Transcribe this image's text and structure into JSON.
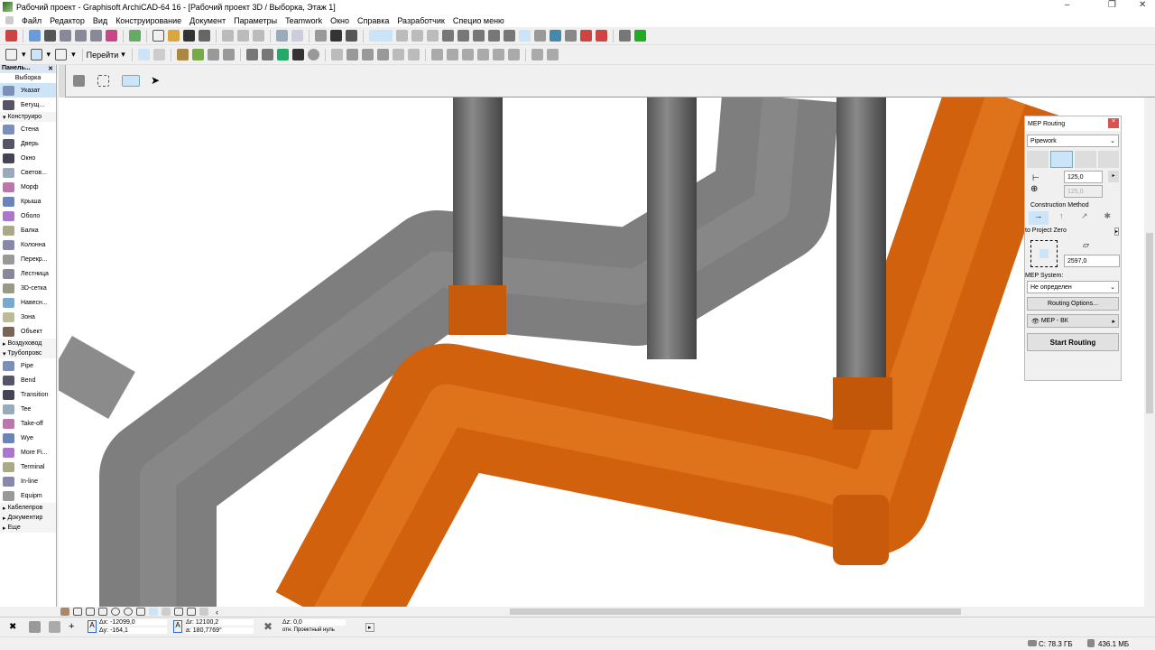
{
  "window": {
    "title": "Рабочий проект - Graphisoft ArchiCAD-64 16 - [Рабочий проект 3D / Выборка, Этаж 1]",
    "minimize": "–",
    "maximize": "❐",
    "close": "✕"
  },
  "menu": [
    "Файл",
    "Редактор",
    "Вид",
    "Конструирование",
    "Документ",
    "Параметры",
    "Teamwork",
    "Окно",
    "Справка",
    "Разработчик",
    "Специо меню"
  ],
  "toolbar2": {
    "goto_label": "Перейти"
  },
  "panel": {
    "title": "Панель...",
    "section": "Выборка",
    "top_items": [
      {
        "label": "Указат",
        "icon": "arrow-pointer-icon"
      },
      {
        "label": "Бегущ...",
        "icon": "marquee-icon"
      }
    ],
    "group1": "Конструиро",
    "design_items": [
      {
        "label": "Стена",
        "icon": "wall-icon"
      },
      {
        "label": "Дверь",
        "icon": "door-icon"
      },
      {
        "label": "Окно",
        "icon": "window-icon"
      },
      {
        "label": "Светов...",
        "icon": "skylight-icon"
      },
      {
        "label": "Морф",
        "icon": "morph-icon"
      },
      {
        "label": "Крыша",
        "icon": "roof-icon"
      },
      {
        "label": "Оболо",
        "icon": "shell-icon"
      },
      {
        "label": "Балка",
        "icon": "beam-icon"
      },
      {
        "label": "Колонна",
        "icon": "column-icon"
      },
      {
        "label": "Перекр...",
        "icon": "slab-icon"
      },
      {
        "label": "Лестница",
        "icon": "stair-icon"
      },
      {
        "label": "3D-сетка",
        "icon": "mesh-icon"
      },
      {
        "label": "Навесн...",
        "icon": "curtain-wall-icon"
      },
      {
        "label": "Зона",
        "icon": "zone-icon"
      },
      {
        "label": "Объект",
        "icon": "object-icon"
      }
    ],
    "group2": "Воздуховод",
    "group3": "Трубопровс",
    "pipe_items": [
      {
        "label": "Pipe",
        "icon": "pipe-icon"
      },
      {
        "label": "Bend",
        "icon": "bend-icon"
      },
      {
        "label": "Transition",
        "icon": "transition-icon"
      },
      {
        "label": "Tee",
        "icon": "tee-icon"
      },
      {
        "label": "Take-off",
        "icon": "take-off-icon"
      },
      {
        "label": "Wye",
        "icon": "wye-icon"
      },
      {
        "label": "More Fi...",
        "icon": "more-fittings-icon"
      },
      {
        "label": "Terminal",
        "icon": "terminal-icon"
      },
      {
        "label": "In-line",
        "icon": "in-line-icon"
      },
      {
        "label": "Equipm",
        "icon": "equipment-icon"
      }
    ],
    "bottom_groups": [
      "Кабелепров",
      "Документир",
      "Еще"
    ]
  },
  "mep": {
    "title": "MEP Routing",
    "type": "Pipework",
    "width": "125,0",
    "height": "125,0",
    "construction_method": "Construction Method",
    "reference": "to Project Zero",
    "elevation": "2597,0",
    "system_label": "MEP System:",
    "system": "Не определен",
    "routing_options": "Routing Options...",
    "layer": "MEP - ВК",
    "start": "Start Routing"
  },
  "coords": {
    "dx": "Δx: -12099,0",
    "dy": "Δy: -164,1",
    "dr": "Δr: 12100,2",
    "angle": "a: 180,7769°",
    "dz": "Δz: 0,0",
    "ref": "отн. Проектный нуль"
  },
  "status": {
    "disk": "C: 78.3 ГБ",
    "memory": "436.1 МБ"
  },
  "colors": {
    "orange": "#d9640f",
    "gray": "#7a7a7a",
    "accent": "#cce4f7"
  }
}
